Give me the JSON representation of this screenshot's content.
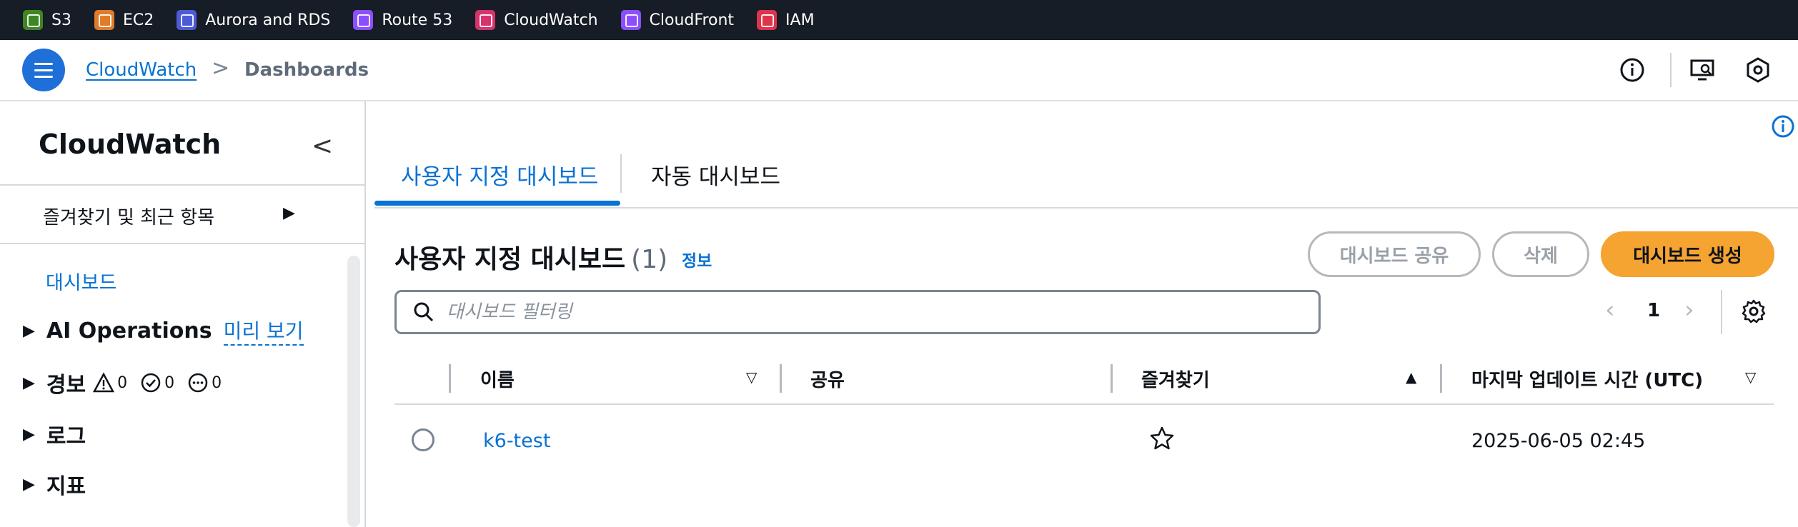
{
  "service_bar": {
    "items": [
      {
        "label": "S3",
        "icon": "s3-icon",
        "color": "#3f8624"
      },
      {
        "label": "EC2",
        "icon": "ec2-icon",
        "color": "#e07b2a"
      },
      {
        "label": "Aurora and RDS",
        "icon": "rds-icon",
        "color": "#4d5bd6"
      },
      {
        "label": "Route 53",
        "icon": "route53-icon",
        "color": "#8c4fff"
      },
      {
        "label": "CloudWatch",
        "icon": "cloudwatch-icon",
        "color": "#d6336c"
      },
      {
        "label": "CloudFront",
        "icon": "cloudfront-icon",
        "color": "#8c4fff"
      },
      {
        "label": "IAM",
        "icon": "iam-icon",
        "color": "#dd344c"
      }
    ]
  },
  "breadcrumb": {
    "root": "CloudWatch",
    "separator": ">",
    "current": "Dashboards"
  },
  "sidebar": {
    "title": "CloudWatch",
    "collapse": "<",
    "favorites": "즐겨찾기 및 최근 항목",
    "dashboards": "대시보드",
    "ai_operations": "AI Operations",
    "preview": "미리 보기",
    "alarms": "경보",
    "alarm_counts": {
      "warning": "0",
      "ok": "0",
      "insufficient": "0"
    },
    "logs": "로그",
    "metrics": "지표"
  },
  "tabs": {
    "custom": "사용자 지정 대시보드",
    "auto": "자동 대시보드"
  },
  "section": {
    "title": "사용자 지정 대시보드",
    "count": "(1)",
    "info": "정보"
  },
  "buttons": {
    "share": "대시보드 공유",
    "delete": "삭제",
    "create": "대시보드 생성"
  },
  "search": {
    "placeholder": "대시보드 필터링"
  },
  "pagination": {
    "prev": "‹",
    "page": "1",
    "next": "›"
  },
  "table": {
    "headers": {
      "name": "이름",
      "shared": "공유",
      "favorite": "즐겨찾기",
      "updated": "마지막 업데이트 시간 (UTC)"
    },
    "rows": [
      {
        "name": "k6-test",
        "shared": "",
        "updated": "2025-06-05 02:45"
      }
    ]
  },
  "colors": {
    "accent": "#0972d3",
    "primary_button": "#f5a331",
    "top_bar": "#161d26"
  }
}
